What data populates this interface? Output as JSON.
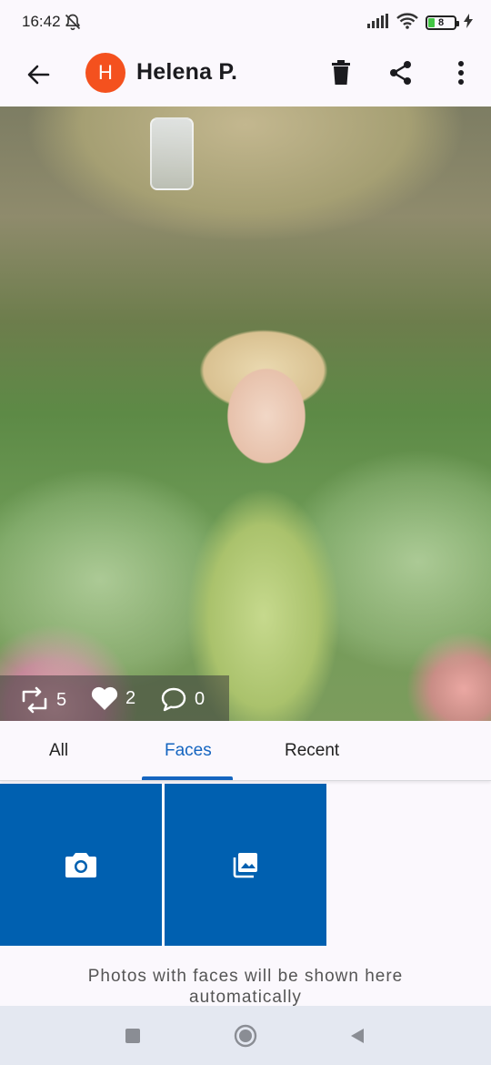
{
  "status_bar": {
    "time": "16:42",
    "battery_level": "8",
    "icons": [
      "bell-off-icon",
      "signal-icon",
      "wifi-icon",
      "battery-icon",
      "charging-icon"
    ]
  },
  "app_bar": {
    "avatar_letter": "H",
    "title": "Helena P.",
    "avatar_color": "#f4511e",
    "actions": [
      "delete-icon",
      "share-icon",
      "more-icon"
    ]
  },
  "photo": {
    "stats": {
      "reposts": "5",
      "likes": "2",
      "comments": "0"
    }
  },
  "tabs": [
    {
      "label": "All"
    },
    {
      "label": "Faces"
    },
    {
      "label": "Recent"
    }
  ],
  "active_tab": "Faces",
  "accent_color": "#1565c0",
  "tiles": [
    {
      "icon": "camera-icon"
    },
    {
      "icon": "gallery-icon"
    }
  ],
  "tile_color": "#0060b0",
  "empty_message": "Photos with faces will be shown here automatically"
}
